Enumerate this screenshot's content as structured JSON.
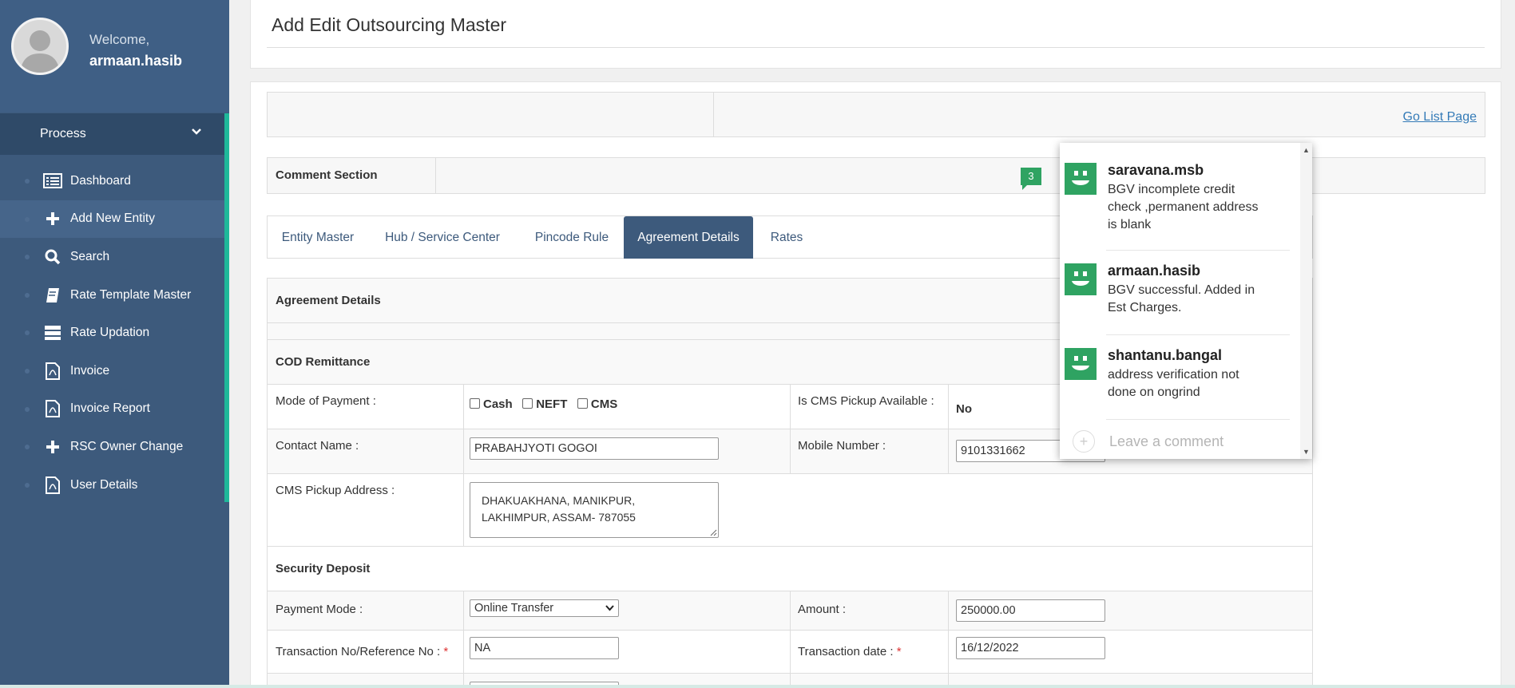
{
  "user": {
    "welcome": "Welcome,",
    "name": "armaan.hasib"
  },
  "sidebar": {
    "section": "Process",
    "items": [
      {
        "label": "Dashboard",
        "icon": "dashboard-icon"
      },
      {
        "label": "Add New Entity",
        "icon": "plus-icon"
      },
      {
        "label": "Search",
        "icon": "search-icon"
      },
      {
        "label": "Rate Template Master",
        "icon": "book-icon"
      },
      {
        "label": "Rate Updation",
        "icon": "server-icon"
      },
      {
        "label": "Invoice",
        "icon": "pdf-file-icon"
      },
      {
        "label": "Invoice Report",
        "icon": "pdf-file-icon"
      },
      {
        "label": "RSC Owner Change",
        "icon": "plus-icon"
      },
      {
        "label": "User Details",
        "icon": "pdf-file-icon"
      }
    ]
  },
  "page": {
    "title": "Add Edit Outsourcing Master",
    "go_list": "Go List Page"
  },
  "comment_section": {
    "label": "Comment Section",
    "count": "3"
  },
  "tabs": [
    "Entity Master",
    "Hub / Service Center",
    "Pincode Rule",
    "Agreement Details",
    "Rates"
  ],
  "form": {
    "agreement_header": "Agreement Details",
    "cod_header": "COD Remittance",
    "mode_of_payment_label": "Mode of Payment :",
    "payment_options": [
      "Cash",
      "NEFT",
      "CMS"
    ],
    "cms_pickup_label": "Is CMS Pickup Available :",
    "cms_pickup_value": "No",
    "contact_name_label": "Contact Name :",
    "contact_name_value": "PRABAHJYOTI GOGOI",
    "mobile_label": "Mobile Number :",
    "mobile_value": "9101331662",
    "cms_address_label": "CMS Pickup Address :",
    "cms_address_line1": "DHAKUAKHANA, MANIKPUR,",
    "cms_address_line2": "LAKHIMPUR, ASSAM- 787055",
    "security_header": "Security Deposit",
    "payment_mode_label": "Payment Mode :",
    "payment_mode_value": "Online Transfer",
    "amount_label": "Amount :",
    "amount_value": "250000.00",
    "txn_no_label": "Transaction No/Reference No :",
    "txn_no_value": "NA",
    "txn_date_label": "Transaction date :",
    "txn_date_value": "16/12/2022",
    "required_mark": "*"
  },
  "comments": [
    {
      "author": "saravana.msb",
      "text": "BGV incomplete credit check ,permanent address is blank"
    },
    {
      "author": "armaan.hasib",
      "text": "BGV successful. Added in Est Charges."
    },
    {
      "author": "shantanu.bangal",
      "text": "address verification not done on ongrind"
    }
  ],
  "leave_comment": "Leave a comment",
  "colors": {
    "sidebar": "#3d5a7c",
    "accent": "#1fb89a",
    "comment_green": "#2fa362",
    "link": "#337ab7"
  }
}
